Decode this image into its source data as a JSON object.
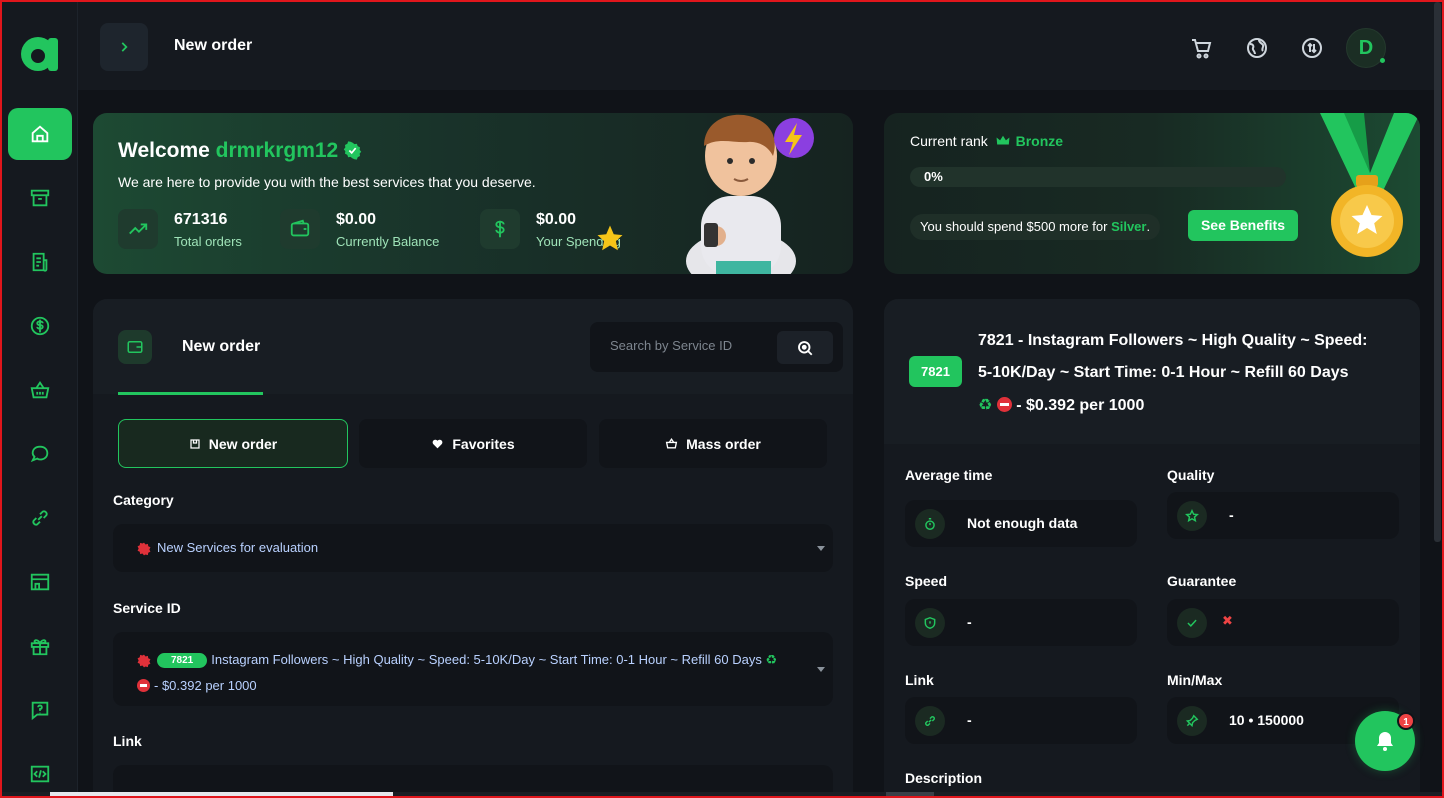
{
  "header": {
    "title": "New order",
    "avatar_letter": "D"
  },
  "sidebar": {
    "items": [
      {
        "name": "home",
        "icon": "home-icon",
        "active": true
      },
      {
        "name": "orders",
        "icon": "archive-icon"
      },
      {
        "name": "services",
        "icon": "document-icon"
      },
      {
        "name": "funds",
        "icon": "dollar-icon"
      },
      {
        "name": "shop",
        "icon": "basket-icon"
      },
      {
        "name": "tickets",
        "icon": "chat-icon"
      },
      {
        "name": "affiliates",
        "icon": "link-icon"
      },
      {
        "name": "store",
        "icon": "storefront-icon"
      },
      {
        "name": "gifts",
        "icon": "gift-icon"
      },
      {
        "name": "faq",
        "icon": "question-icon"
      },
      {
        "name": "api",
        "icon": "code-icon"
      }
    ]
  },
  "welcome": {
    "greeting": "Welcome",
    "username": "drmrkrgm12",
    "subtitle": "We are here to provide you with the best services that you deserve.",
    "stats": [
      {
        "value": "671316",
        "label": "Total orders"
      },
      {
        "value": "$0.00",
        "label": "Currently Balance"
      },
      {
        "value": "$0.00",
        "label": "Your Spending"
      }
    ]
  },
  "rank": {
    "label": "Current rank",
    "tier": "Bronze",
    "progress_value": 0,
    "progress_text": "0%",
    "spend_prefix": "You should spend $500 more for",
    "spend_next": "Silver",
    "spend_suffix": ".",
    "benefits_label": "See Benefits"
  },
  "order_form": {
    "tab_title": "New order",
    "search_placeholder": "Search by Service ID",
    "tabs": [
      "New order",
      "Favorites",
      "Mass order"
    ],
    "category_label": "Category",
    "category_value": "New Services for evaluation",
    "service_label": "Service ID",
    "service_id": "7821",
    "service_text_line1": "Instagram Followers ~ High Quality ~ Speed: 5-10K/Day ~ Start Time: 0-1 Hour ~ Refill 60 Days",
    "service_text_line2": "- $0.392 per 1000",
    "link_label": "Link"
  },
  "details": {
    "service_id": "7821",
    "title_line1": "7821 - Instagram Followers ~ High Quality ~ Speed:",
    "title_line2": "5-10K/Day ~ Start Time: 0-1 Hour ~ Refill 60 Days",
    "title_line3": "- $0.392 per 1000",
    "fields": {
      "average_time": {
        "label": "Average time",
        "value": "Not enough data"
      },
      "quality": {
        "label": "Quality",
        "value": "-"
      },
      "speed": {
        "label": "Speed",
        "value": "-"
      },
      "guarantee": {
        "label": "Guarantee",
        "value": "✖"
      },
      "link": {
        "label": "Link",
        "value": "-"
      },
      "minmax": {
        "label": "Min/Max",
        "value": "10 • 150000"
      }
    },
    "description_label": "Description"
  },
  "notifications": {
    "count": "1"
  },
  "colors": {
    "accent": "#22c55e",
    "background": "#101318",
    "panel": "#15191f",
    "danger": "#ef4444"
  }
}
